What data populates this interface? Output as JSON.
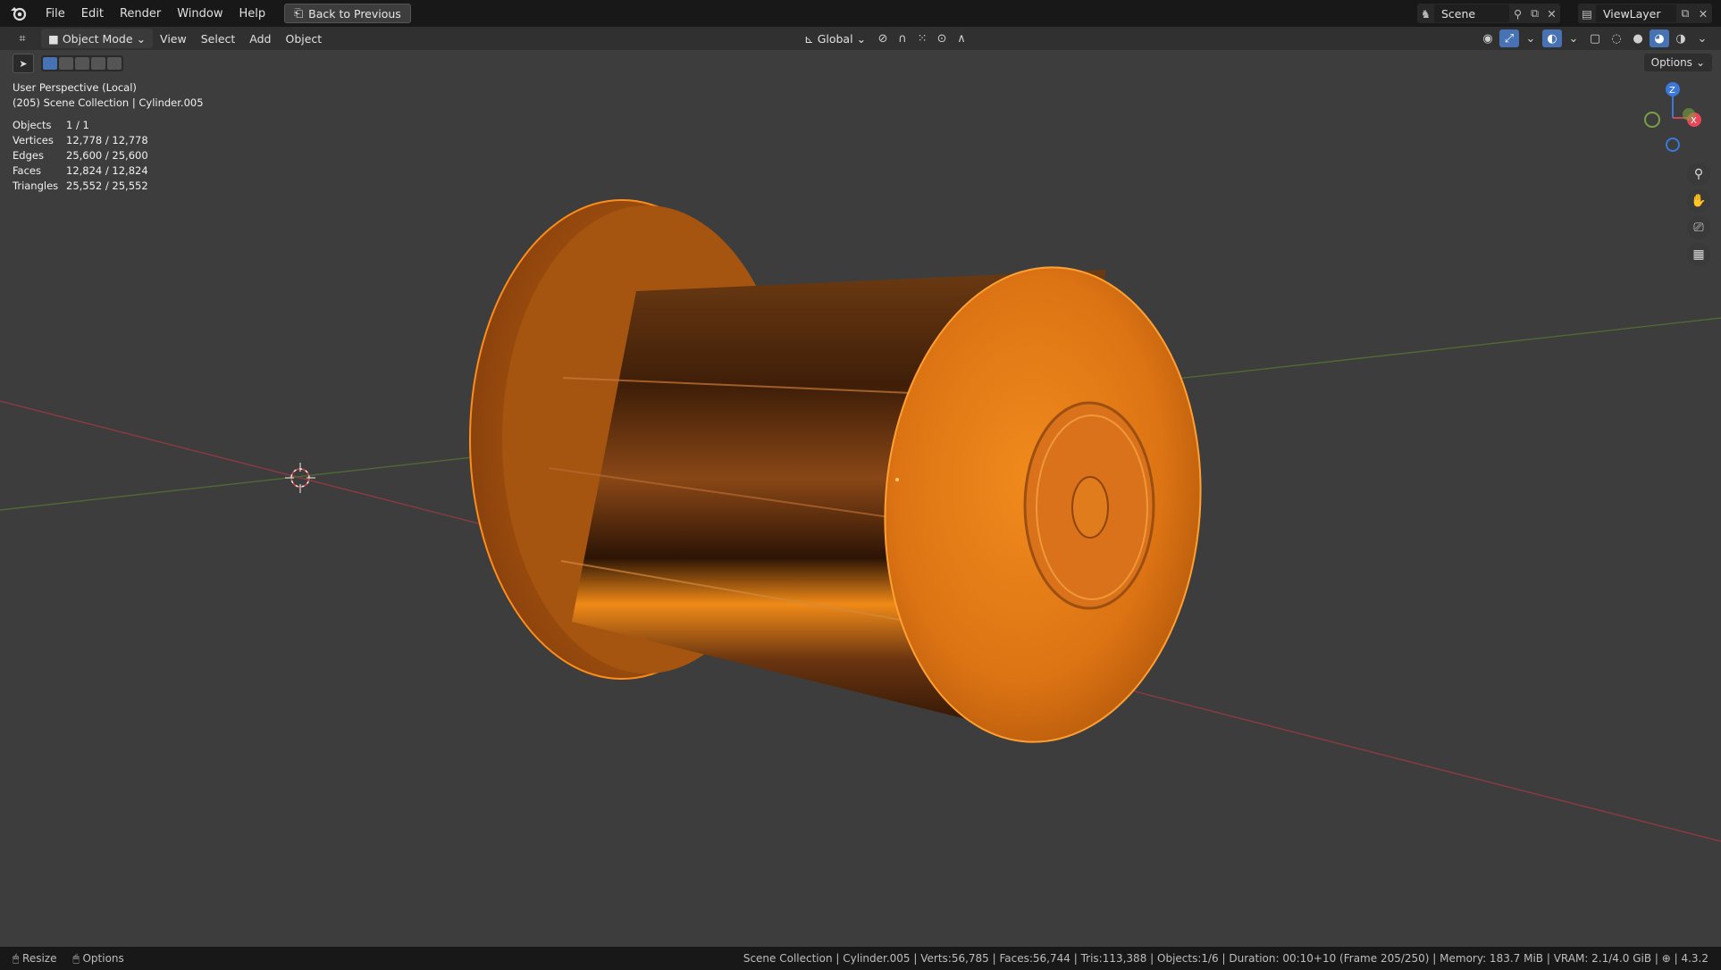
{
  "menu": {
    "items": [
      "File",
      "Edit",
      "Render",
      "Window",
      "Help"
    ],
    "back_button": "Back to Previous"
  },
  "scene": {
    "name": "Scene"
  },
  "view_layer": {
    "name": "ViewLayer"
  },
  "viewport_header": {
    "mode": "Object Mode",
    "menus": [
      "View",
      "Select",
      "Add",
      "Object"
    ],
    "transform_orientation": "Global"
  },
  "viewport": {
    "options_label": "Options",
    "perspective": "User Perspective (Local)",
    "collection_info": "(205) Scene Collection | Cylinder.005",
    "stats": [
      {
        "label": "Objects",
        "value": "1 / 1"
      },
      {
        "label": "Vertices",
        "value": "12,778 / 12,778"
      },
      {
        "label": "Edges",
        "value": "25,600 / 25,600"
      },
      {
        "label": "Faces",
        "value": "12,824 / 12,824"
      },
      {
        "label": "Triangles",
        "value": "25,552 / 25,552"
      }
    ],
    "gizmo_axes": [
      "Z",
      "X"
    ]
  },
  "statusbar": {
    "left": [
      "Resize",
      "Options"
    ],
    "info": "Scene Collection | Cylinder.005 | Verts:56,785 | Faces:56,744 | Tris:113,388 | Objects:1/6 | Duration: 00:10+10 (Frame 205/250) | Memory: 183.7 MiB | VRAM: 2.1/4.0 GiB | ⊕ | 4.3.2"
  },
  "colors": {
    "accent": "#4772b3",
    "object_orange": "#e07a1a",
    "axis_x": "#c24a52",
    "axis_y": "#6a8a3a"
  }
}
